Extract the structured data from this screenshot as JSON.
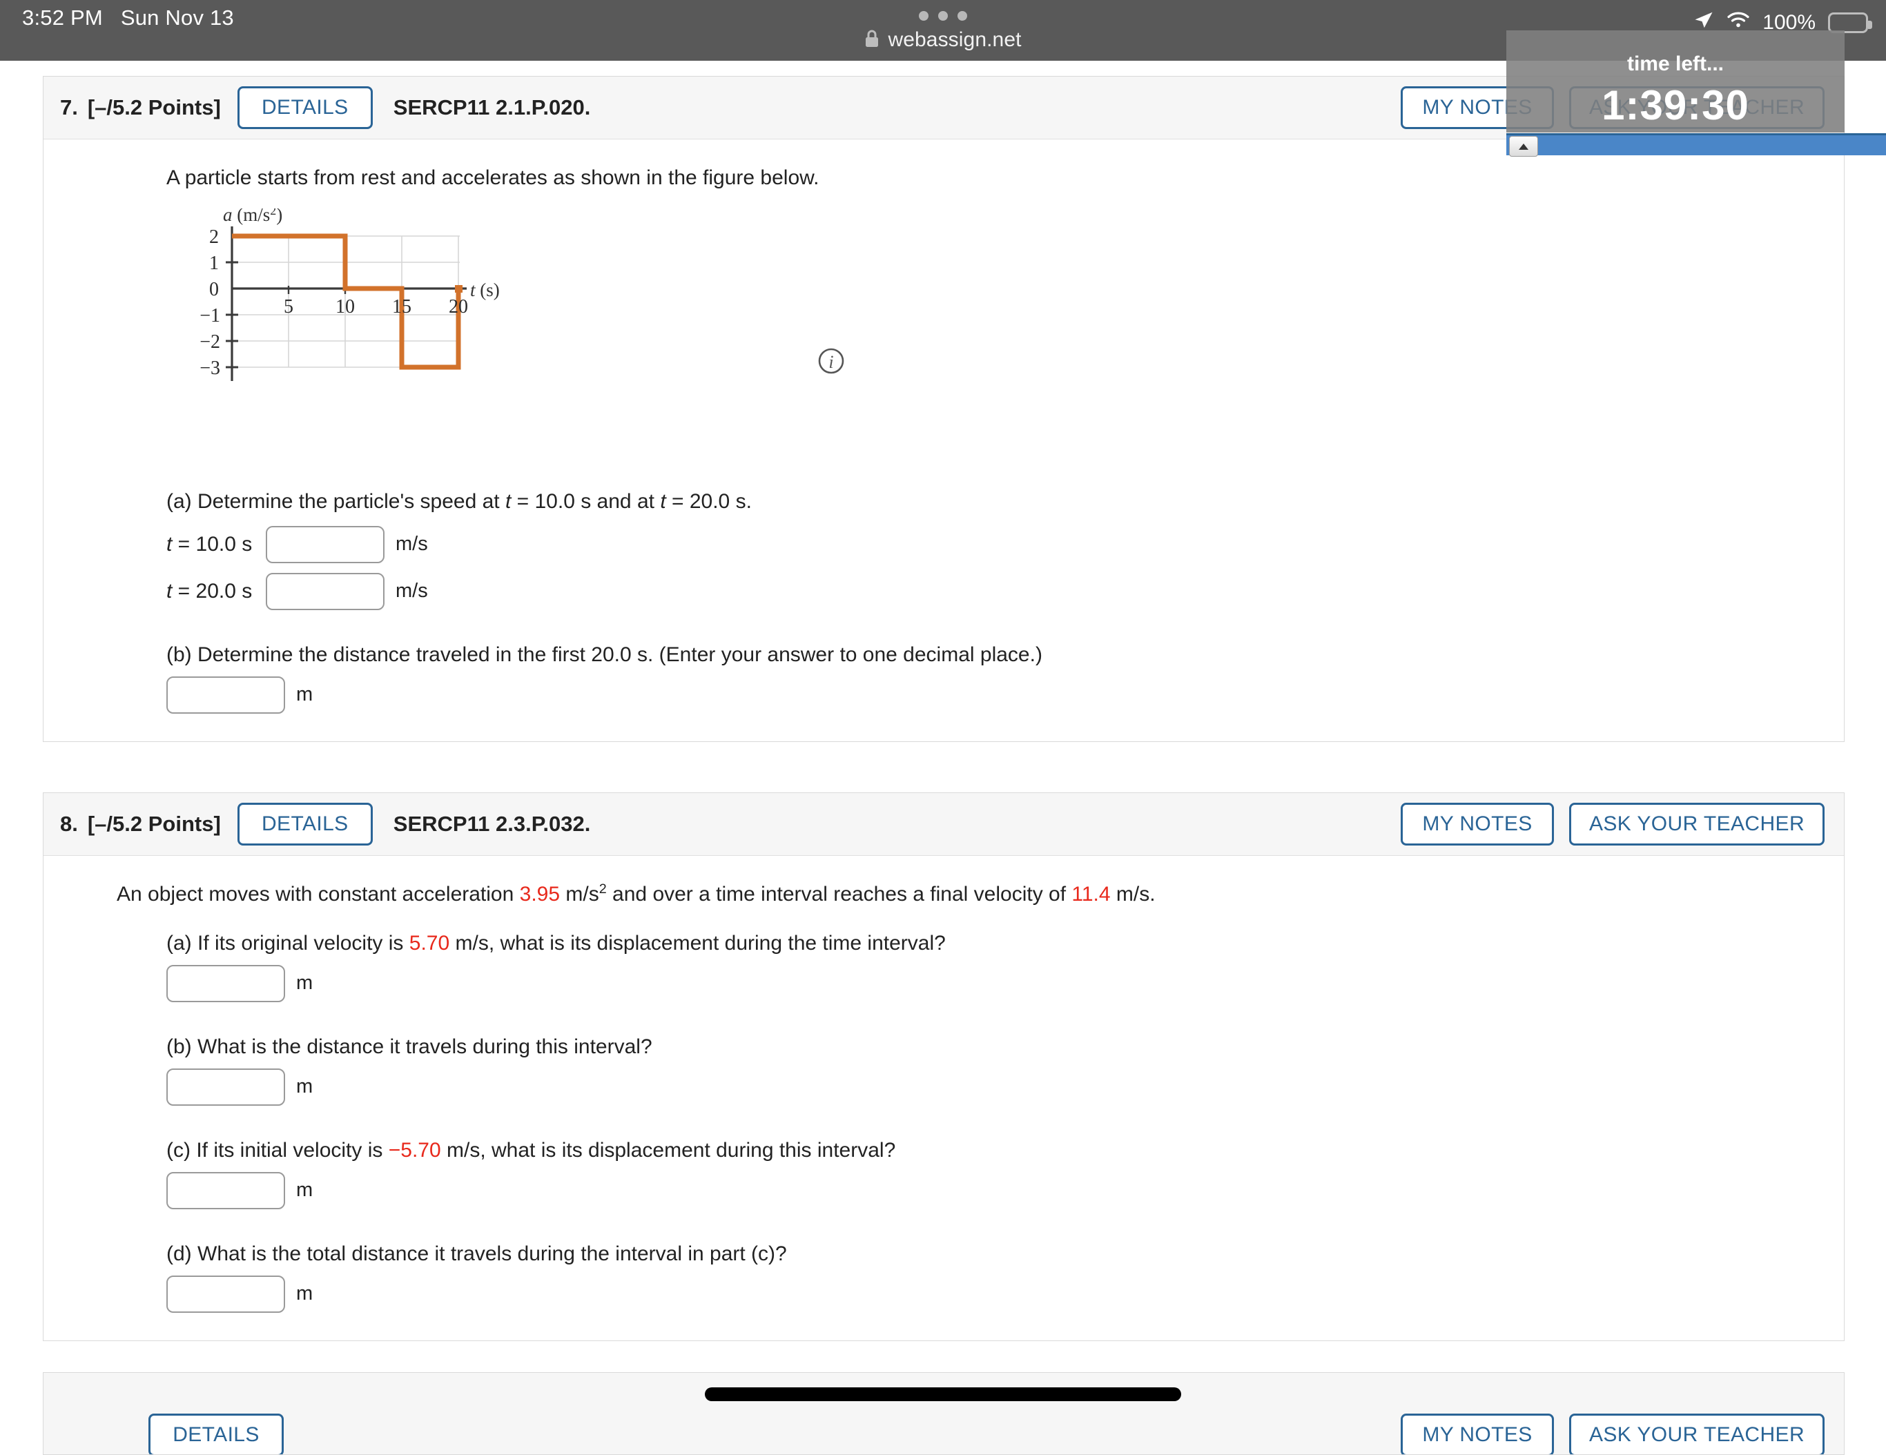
{
  "status_bar": {
    "time": "3:52 PM",
    "date": "Sun Nov 13",
    "url": "webassign.net",
    "battery_percent": "100%",
    "lock_icon": "lock-icon",
    "wifi_icon": "wifi-icon",
    "location_icon": "location-arrow-icon",
    "battery_icon": "battery-icon",
    "tab_dots_icon": "tab-overview-dots-icon",
    "battery_color": "#f5d33a"
  },
  "timer": {
    "label": "time left...",
    "value": "1:39:30",
    "collapse_icon": "triangle-up-icon"
  },
  "theme": {
    "accent_blue": "#2a6496",
    "red_value": "#e8291c",
    "graph_orange": "#d2722b"
  },
  "questions": [
    {
      "number": "7.",
      "points": "[–/5.2 Points]",
      "details_label": "DETAILS",
      "code": "SERCP11 2.1.P.020.",
      "my_notes_label": "MY NOTES",
      "ask_teacher_label": "ASK YOUR TEACHER",
      "prompt": "A particle starts from rest and accelerates as shown in the figure below.",
      "info_icon": "info-circle-icon",
      "parts": [
        {
          "label_pre": "(a) Determine the particle's speed at ",
          "label_t1": "t",
          "label_mid1": " = 10.0 s and at ",
          "label_t2": "t",
          "label_post": " = 20.0 s.",
          "rows": [
            {
              "lead_italic": "t",
              "lead_rest": " = 10.0 s",
              "value": "",
              "unit": "m/s"
            },
            {
              "lead_italic": "t",
              "lead_rest": " = 20.0 s",
              "value": "",
              "unit": "m/s"
            }
          ]
        },
        {
          "text": "(b) Determine the distance traveled in the first 20.0 s. (Enter your answer to one decimal place.)",
          "value": "",
          "unit": "m"
        }
      ]
    },
    {
      "number": "8.",
      "points": "[–/5.2 Points]",
      "details_label": "DETAILS",
      "code": "SERCP11 2.3.P.032.",
      "my_notes_label": "MY NOTES",
      "ask_teacher_label": "ASK YOUR TEACHER",
      "prompt_pre": "An object moves with constant acceleration ",
      "prompt_accel": "3.95",
      "prompt_mid": " m/s",
      "prompt_exp": "2",
      "prompt_mid2": " and over a time interval reaches a final velocity of ",
      "prompt_vel": "11.4",
      "prompt_end": " m/s.",
      "parts": [
        {
          "pre": "(a) If its original velocity is ",
          "value_red": "5.70",
          "post": " m/s, what is its displacement during the time interval?",
          "value": "",
          "unit": "m"
        },
        {
          "pre": "(b) What is the distance it travels during this interval?",
          "value_red": "",
          "post": "",
          "value": "",
          "unit": "m"
        },
        {
          "pre": "(c) If its initial velocity is ",
          "value_red": "−5.70",
          "post": " m/s, what is its displacement during this interval?",
          "value": "",
          "unit": "m"
        },
        {
          "pre": "(d) What is the total distance it travels during the interval in part (c)?",
          "value_red": "",
          "post": "",
          "value": "",
          "unit": "m"
        }
      ]
    }
  ],
  "chart_data": {
    "type": "line",
    "style": "step",
    "title": "",
    "xlabel": "t (s)",
    "ylabel": "a (m/s2)",
    "ylabel_base": "a (m/s",
    "ylabel_exp": "2",
    "ylabel_close": ")",
    "xlim": [
      0,
      22
    ],
    "ylim": [
      -3.6,
      2.4
    ],
    "xticks": [
      5,
      10,
      15,
      20
    ],
    "yticks": [
      2,
      1,
      0,
      -1,
      -2,
      -3
    ],
    "ytick_labels": [
      "2",
      "1",
      "0",
      "−1",
      "−2",
      "−3"
    ],
    "xtick_labels": [
      "5",
      "10",
      "15",
      "20"
    ],
    "grid": true,
    "series": [
      {
        "name": "acceleration",
        "color": "#d2722b",
        "segments": [
          {
            "t_start": 0,
            "t_end": 10,
            "a": 2
          },
          {
            "t_start": 10,
            "t_end": 15,
            "a": 0
          },
          {
            "t_start": 15,
            "t_end": 20,
            "a": -3
          }
        ],
        "points": [
          [
            0,
            2
          ],
          [
            10,
            2
          ],
          [
            10,
            0
          ],
          [
            15,
            0
          ],
          [
            15,
            -3
          ],
          [
            20,
            -3
          ],
          [
            20,
            0
          ]
        ]
      }
    ]
  }
}
